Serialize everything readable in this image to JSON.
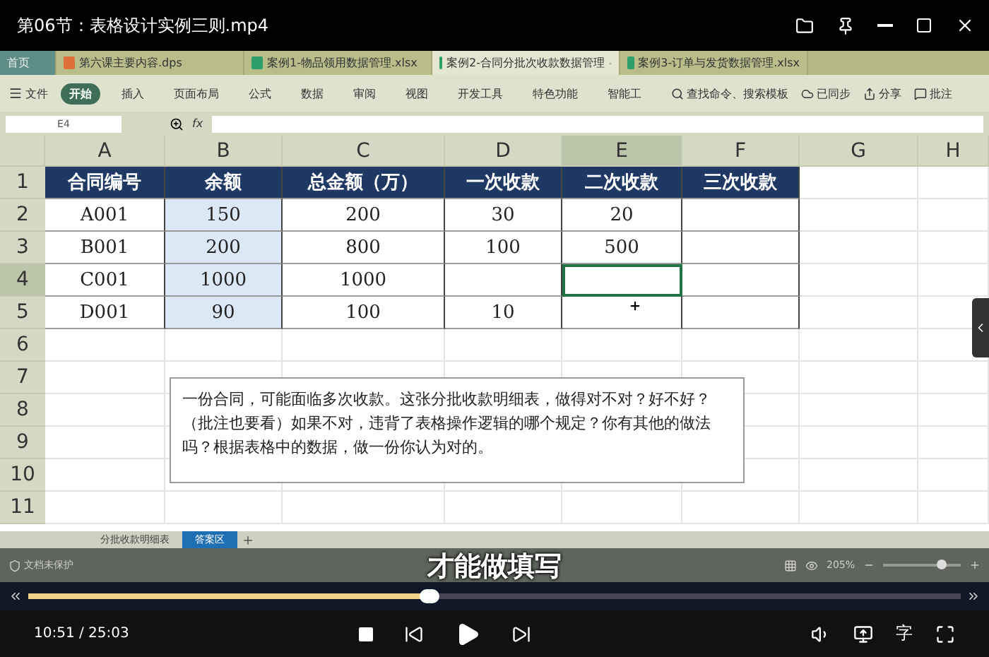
{
  "window": {
    "title": "第06节：表格设计实例三则.mp4"
  },
  "tabs": [
    {
      "label": "首页",
      "kind": "home",
      "selected": false
    },
    {
      "label": "第六课主要内容.dps",
      "kind": "slides",
      "selected": false
    },
    {
      "label": "案例1-物品领用数据管理.xlsx",
      "kind": "sheet",
      "selected": false
    },
    {
      "label": "案例2-合同分批次收款数据管理",
      "kind": "sheet",
      "selected": true
    },
    {
      "label": "案例3-订单与发货数据管理.xlsx",
      "kind": "sheet",
      "selected": false
    }
  ],
  "ribbon": {
    "menu_label": "文件",
    "items": [
      {
        "label": "开始",
        "selected": true
      },
      {
        "label": "插入",
        "selected": false
      },
      {
        "label": "页面布局",
        "selected": false
      },
      {
        "label": "公式",
        "selected": false
      },
      {
        "label": "数据",
        "selected": false
      },
      {
        "label": "审阅",
        "selected": false
      },
      {
        "label": "视图",
        "selected": false
      },
      {
        "label": "开发工具",
        "selected": false
      },
      {
        "label": "特色功能",
        "selected": false
      },
      {
        "label": "智能工",
        "selected": false
      }
    ],
    "search": {
      "placeholder": "查找命令、搜索模板"
    },
    "sync": "已同步",
    "share": "分享",
    "comment": "批注"
  },
  "formula_bar": {
    "cell": "E4",
    "fx": "fx"
  },
  "sheet": {
    "columns": [
      {
        "label": "A",
        "selected": false
      },
      {
        "label": "B",
        "selected": false
      },
      {
        "label": "C",
        "selected": false
      },
      {
        "label": "D",
        "selected": false
      },
      {
        "label": "E",
        "selected": true
      },
      {
        "label": "F",
        "selected": false
      },
      {
        "label": "G",
        "selected": false
      },
      {
        "label": "H",
        "selected": false
      }
    ],
    "rows": [
      {
        "label": "1",
        "selected": false,
        "kind": "header",
        "cells": [
          "合同编号",
          "余额",
          "总金额（万）",
          "一次收款",
          "二次收款",
          "三次收款"
        ]
      },
      {
        "label": "2",
        "selected": false,
        "kind": "data",
        "cells": [
          "A001",
          "150",
          "200",
          "30",
          "20",
          ""
        ]
      },
      {
        "label": "3",
        "selected": false,
        "kind": "data",
        "cells": [
          "B001",
          "200",
          "800",
          "100",
          "500",
          ""
        ]
      },
      {
        "label": "4",
        "selected": true,
        "kind": "data",
        "cells": [
          "C001",
          "1000",
          "1000",
          "",
          "",
          ""
        ]
      },
      {
        "label": "5",
        "selected": false,
        "kind": "data",
        "cells": [
          "D001",
          "90",
          "100",
          "10",
          "",
          ""
        ]
      },
      {
        "label": "6",
        "selected": false,
        "kind": "empty",
        "cells": []
      },
      {
        "label": "7",
        "selected": false,
        "kind": "empty",
        "cells": []
      },
      {
        "label": "8",
        "selected": false,
        "kind": "empty",
        "cells": []
      },
      {
        "label": "9",
        "selected": false,
        "kind": "empty",
        "cells": []
      },
      {
        "label": "10",
        "selected": false,
        "kind": "empty",
        "cells": []
      },
      {
        "label": "11",
        "selected": false,
        "kind": "empty",
        "cells": []
      }
    ],
    "note": "一份合同，可能面临多次收款。这张分批收款明细表，做得对不对？好不好？（批注也要看）如果不对，违背了表格操作逻辑的哪个规定？你有其他的做法吗？根据表格中的数据，做一份你认为对的。"
  },
  "sheet_tabs": [
    {
      "label": "分批收款明细表",
      "selected": false
    },
    {
      "label": "答案区",
      "selected": true
    }
  ],
  "status_bar": {
    "protection": "文档未保护",
    "zoom": "205%",
    "zoom_slider": {
      "level": 0.75
    }
  },
  "subtitle": "才能做填写",
  "player": {
    "level": 0.43,
    "time": "10:51 / 25:03",
    "subtitle_button": "字"
  }
}
